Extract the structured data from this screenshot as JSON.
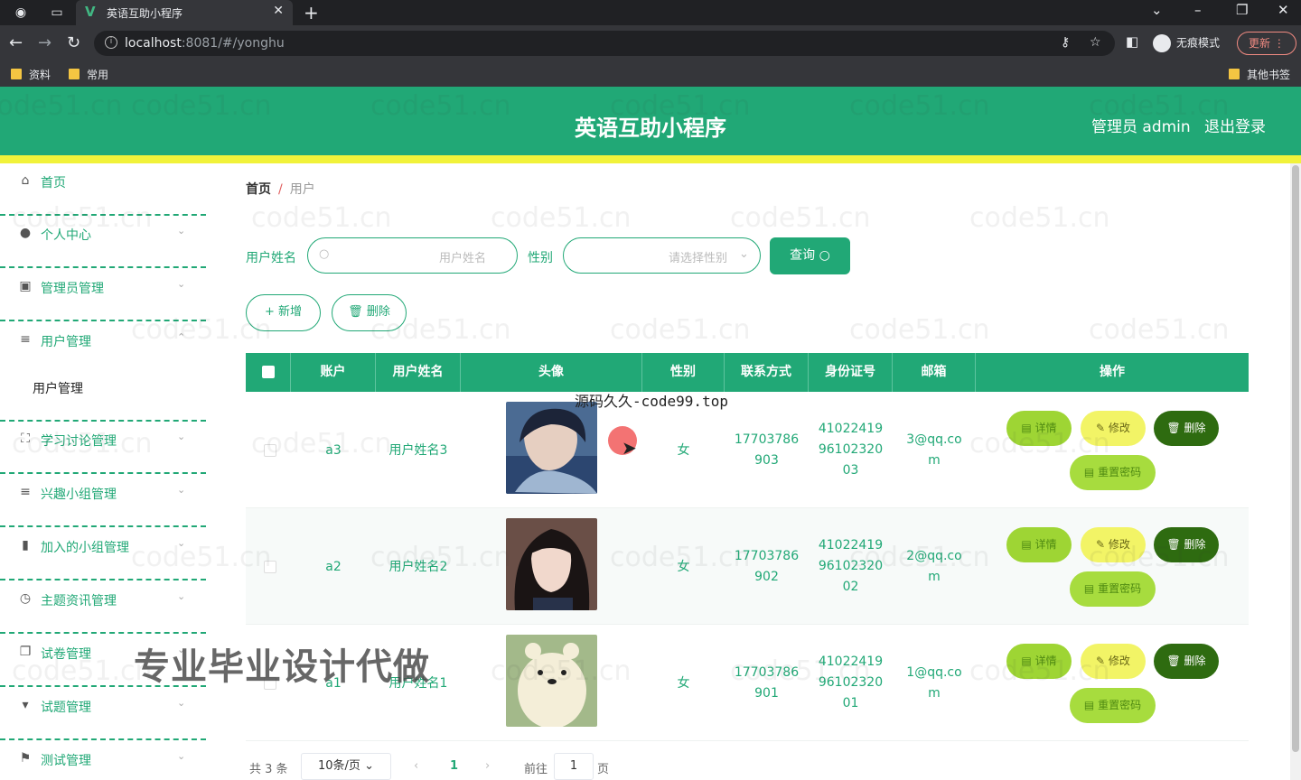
{
  "browser": {
    "tab_title": "英语互助小程序",
    "url_host": "localhost",
    "url_rest": ":8081/#/yonghu",
    "incognito_label": "无痕模式",
    "update_label": "更新",
    "bookmarks": [
      "资料",
      "常用"
    ],
    "other_bookmarks": "其他书签"
  },
  "header": {
    "title": "英语互助小程序",
    "admin": "管理员 admin",
    "logout": "退出登录"
  },
  "sidebar": {
    "items": [
      {
        "label": "首页",
        "icon": "home-icon"
      },
      {
        "label": "个人中心",
        "icon": "user-icon"
      },
      {
        "label": "管理员管理",
        "icon": "admin-icon"
      },
      {
        "label": "用户管理",
        "icon": "list-icon"
      },
      {
        "label": "学习讨论管理",
        "icon": "frame-icon"
      },
      {
        "label": "兴趣小组管理",
        "icon": "list-icon"
      },
      {
        "label": "加入的小组管理",
        "icon": "chart-icon"
      },
      {
        "label": "主题资讯管理",
        "icon": "clock-icon"
      },
      {
        "label": "试卷管理",
        "icon": "copy-icon"
      },
      {
        "label": "试题管理",
        "icon": "pin-icon"
      },
      {
        "label": "测试管理",
        "icon": "flag-icon"
      }
    ],
    "submenu_active": "用户管理"
  },
  "breadcrumb": {
    "home": "首页",
    "sep": "/",
    "current": "用户"
  },
  "search": {
    "name_label": "用户姓名",
    "name_placeholder": "用户姓名",
    "gender_label": "性别",
    "gender_placeholder": "请选择性别",
    "query_button": "查询"
  },
  "actions": {
    "add": "+ 新增",
    "delete": "删除"
  },
  "table": {
    "headers": [
      "账户",
      "用户姓名",
      "头像",
      "性别",
      "联系方式",
      "身份证号",
      "邮箱",
      "操作"
    ],
    "rows": [
      {
        "account": "a3",
        "name": "用户姓名3",
        "gender": "女",
        "phone1": "17703786",
        "phone2": "903",
        "id1": "41022419",
        "id2": "96102320",
        "id3": "03",
        "email1": "3@qq.co",
        "email2": "m"
      },
      {
        "account": "a2",
        "name": "用户姓名2",
        "gender": "女",
        "phone1": "17703786",
        "phone2": "902",
        "id1": "41022419",
        "id2": "96102320",
        "id3": "02",
        "email1": "2@qq.co",
        "email2": "m"
      },
      {
        "account": "a1",
        "name": "用户姓名1",
        "gender": "女",
        "phone1": "17703786",
        "phone2": "901",
        "id1": "41022419",
        "id2": "96102320",
        "id3": "01",
        "email1": "1@qq.co",
        "email2": "m"
      }
    ],
    "btn_detail": "详情",
    "btn_edit": "修改",
    "btn_delete": "删除",
    "btn_reset": "重置密码"
  },
  "pagination": {
    "total": "共 3 条",
    "page_size": "10条/页",
    "current_page": "1",
    "goto_prefix": "前往",
    "goto_value": "1",
    "goto_suffix": "页"
  },
  "overlays": {
    "top_text": "源码久久-code99.top",
    "big_text": "专业毕业设计代做",
    "watermark": "code51.cn"
  },
  "colors": {
    "primary": "#21a876",
    "header_stripe": "#f1f23a",
    "detail": "#9ed534",
    "edit": "#f2f466",
    "delete": "#2e6b10"
  }
}
